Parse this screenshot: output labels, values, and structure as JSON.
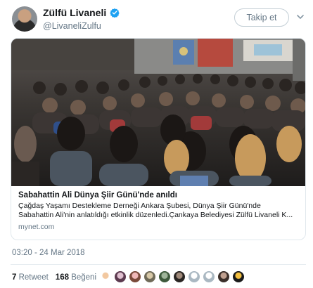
{
  "author": {
    "name": "Zülfü Livaneli",
    "handle": "@LivaneliZulfu",
    "verified": true
  },
  "follow_button": {
    "label": "Takip et"
  },
  "card": {
    "title": "Sabahattin Ali Dünya Şiir Günü'nde anıldı",
    "desc_line1": "Çağdaş Yaşamı Destekleme Derneği Ankara Şubesi, Dünya Şiir Günü'nde",
    "desc_line2": "Sabahattin Ali'nin anlatıldığı etkinlik düzenledi.Çankaya Belediyesi Zülfü Livaneli K...",
    "domain": "mynet.com"
  },
  "timestamp": "03:20 - 24 Mar 2018",
  "stats": {
    "retweet_count": "7",
    "retweet_label": "Retweet",
    "like_count": "168",
    "like_label": "Beğeni"
  },
  "colors": {
    "accent": "#1da1f2",
    "secondary_text": "#657786",
    "border": "#e1e8ed"
  },
  "icons": [
    "verified-badge-icon",
    "chevron-down-icon"
  ]
}
